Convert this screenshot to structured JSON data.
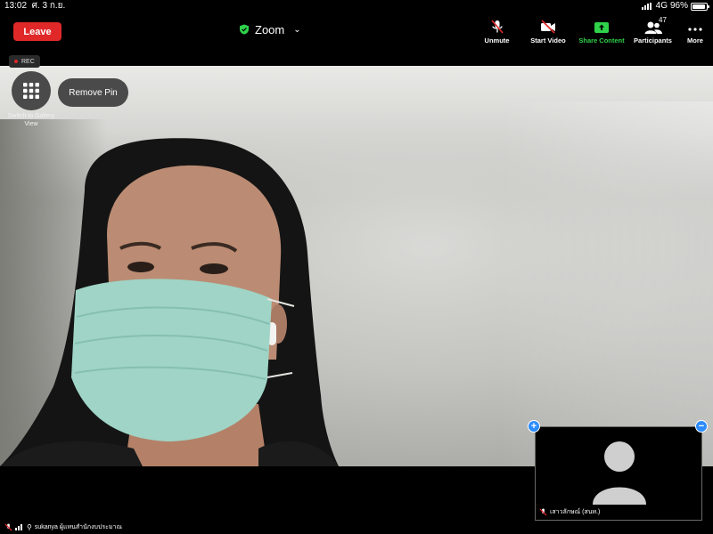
{
  "status_bar": {
    "time": "13:02",
    "date": "ศ. 3 ก.ย.",
    "network": "4G",
    "battery": "96%"
  },
  "header": {
    "leave_label": "Leave",
    "meeting_title": "Zoom",
    "toolbar": {
      "unmute": "Unmute",
      "start_video": "Start Video",
      "share_content": "Share Content",
      "participants": "Participants",
      "participants_count": "47",
      "more": "More"
    }
  },
  "video": {
    "rec_label": "REC",
    "gallery_label": "Switch to Gallery View",
    "remove_pin_label": "Remove Pin",
    "active_speaker_name": "sukanya ผู้แทนสำนักงบประมาณ"
  },
  "self_view": {
    "name": "เสาวลักษณ์ (สนท.)"
  },
  "colors": {
    "leave": "#e02828",
    "share": "#2fd24a",
    "pin": "#2d8cff"
  }
}
